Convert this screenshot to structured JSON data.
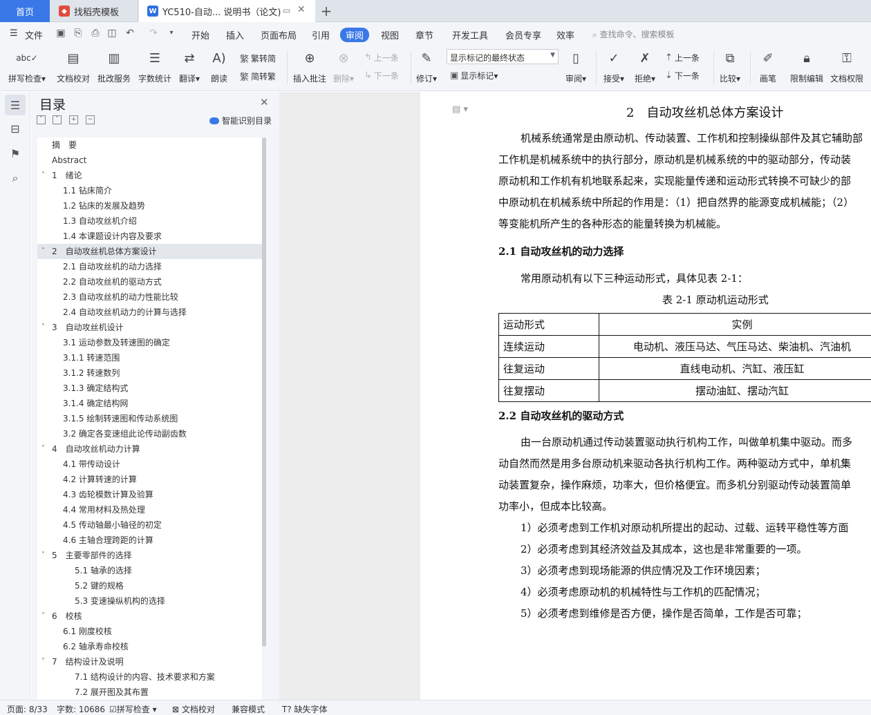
{
  "tabs": {
    "home": "首页",
    "template": "找稻壳模板",
    "doc": "YC510-自动... 说明书（论文)"
  },
  "menu": {
    "file": "文件",
    "items": [
      "开始",
      "插入",
      "页面布局",
      "引用",
      "审阅",
      "视图",
      "章节",
      "开发工具",
      "会员专享",
      "效率"
    ],
    "active": "审阅",
    "search": "查找命令、搜索模板"
  },
  "ribbon": {
    "spell": "拼写检查",
    "proofread": "文档校对",
    "batch": "批改服务",
    "wordcount": "字数统计",
    "translate": "翻译",
    "read": "朗读",
    "to_trad": "繁转简",
    "to_simp": "简转繁",
    "insert_comment": "插入批注",
    "delete": "删除",
    "prev": "上一条",
    "next": "下一条",
    "track": "修订",
    "markup_state": "显示标记的最终状态",
    "show_markup": "显示标记",
    "review": "审阅",
    "accept": "接受",
    "reject": "拒绝",
    "prev2": "上一条",
    "next2": "下一条",
    "compare": "比较",
    "pen": "画笔",
    "restrict": "限制编辑",
    "permission": "文档权限"
  },
  "toc": {
    "title": "目录",
    "smart": "智能识别目录",
    "items": [
      {
        "label": "摘　要"
      },
      {
        "label": "Abstract"
      },
      {
        "label": "1　绪论"
      },
      {
        "label": "1.1  钻床简介"
      },
      {
        "label": "1.2  钻床的发展及趋势"
      },
      {
        "label": "1.3  自动攻丝机介绍"
      },
      {
        "label": "1.4  本课题设计内容及要求"
      },
      {
        "label": "2　自动攻丝机总体方案设计"
      },
      {
        "label": "2.1  自动攻丝机的动力选择"
      },
      {
        "label": "2.2  自动攻丝机的驱动方式"
      },
      {
        "label": "2.3  自动攻丝机的动力性能比较"
      },
      {
        "label": "2.4  自动攻丝机动力的计算与选择"
      },
      {
        "label": "3　自动攻丝机设计"
      },
      {
        "label": "3.1  运动参数及转速图的确定"
      },
      {
        "label": "3.1.1 转速范围"
      },
      {
        "label": "3.1.2 转速数列"
      },
      {
        "label": "3.1.3 确定结构式"
      },
      {
        "label": "3.1.4 确定结构网"
      },
      {
        "label": "3.1.5 绘制转速图和传动系统图"
      },
      {
        "label": "3.2  确定各变速组此论传动副齿数"
      },
      {
        "label": "4　自动攻丝机动力计算"
      },
      {
        "label": "4.1  带传动设计"
      },
      {
        "label": "4.2  计算转速的计算"
      },
      {
        "label": "4.3  齿轮模数计算及验算"
      },
      {
        "label": "4.4  常用材料及热处理"
      },
      {
        "label": "4.5  传动轴最小轴径的初定"
      },
      {
        "label": "4.6  主轴合理跨距的计算"
      },
      {
        "label": "5　主要零部件的选择"
      },
      {
        "label": "5.1  轴承的选择"
      },
      {
        "label": "5.2  键的规格"
      },
      {
        "label": "5.3  变速操纵机构的选择"
      },
      {
        "label": "6　校核"
      },
      {
        "label": "6.1  刚度校核"
      },
      {
        "label": "6.2  轴承寿命校核"
      },
      {
        "label": "7　结构设计及说明"
      },
      {
        "label": "7.1  结构设计的内容、技术要求和方案"
      },
      {
        "label": "7.2  展开图及其布置"
      }
    ]
  },
  "doc": {
    "title": "2　自动攻丝机总体方案设计",
    "para1": [
      "机械系统通常是由原动机、传动装置、工作机和控制操纵部件及其它辅助部",
      "工作机是机械系统中的执行部分，原动机是机械系统的中的驱动部分，传动装",
      "原动机和工作机有机地联系起来，实现能量传递和运动形式转换不可缺少的部",
      "中原动机在机械系统中所起的作用是：（1）把自然界的能源变成机械能；（2）",
      "等变能机所产生的各种形态的能量转换为机械能。"
    ],
    "h21": "2.1  自动攻丝机的动力选择",
    "para2": "常用原动机有以下三种运动形式，具体见表 2-1：",
    "caption": "表 2-1  原动机运动形式",
    "table": {
      "header": [
        "运动形式",
        "实例"
      ],
      "rows": [
        [
          "连续运动",
          "电动机、液压马达、气压马达、柴油机、汽油机"
        ],
        [
          "往复运动",
          "直线电动机、汽缸、液压缸"
        ],
        [
          "往复摆动",
          "摆动油缸、摆动汽缸"
        ]
      ]
    },
    "h22": "2.2  自动攻丝机的驱动方式",
    "para3": [
      "由一台原动机通过传动装置驱动执行机构工作，叫做单机集中驱动。而多",
      "动自然而然是用多台原动机来驱动各执行机构工作。两种驱动方式中，单机集",
      "动装置复杂，操作麻烦，功率大，但价格便宜。而多机分别驱动传动装置简单",
      "功率小，但成本比较高。"
    ],
    "list": [
      "1）必须考虑到工作机对原动机所提出的起动、过载、运转平稳性等方面",
      "2）必须考虑到其经济效益及其成本，这也是非常重要的一项。",
      "3）必须考虑到现场能源的供应情况及工作环境因素；",
      "4）必须考虑原动机的机械特性与工作机的匹配情况；",
      "5）必须考虑到维修是否方便，操作是否简单，工作是否可靠；"
    ]
  },
  "status": {
    "page": "页面: 8/33",
    "words": "字数: 10686",
    "spell": "拼写检查",
    "proof": "文档校对",
    "compat": "兼容模式",
    "missing_font": "缺失字体"
  },
  "colors": {
    "accent": "#3a78e8",
    "ribbon_bg": "#f3f5f8"
  }
}
